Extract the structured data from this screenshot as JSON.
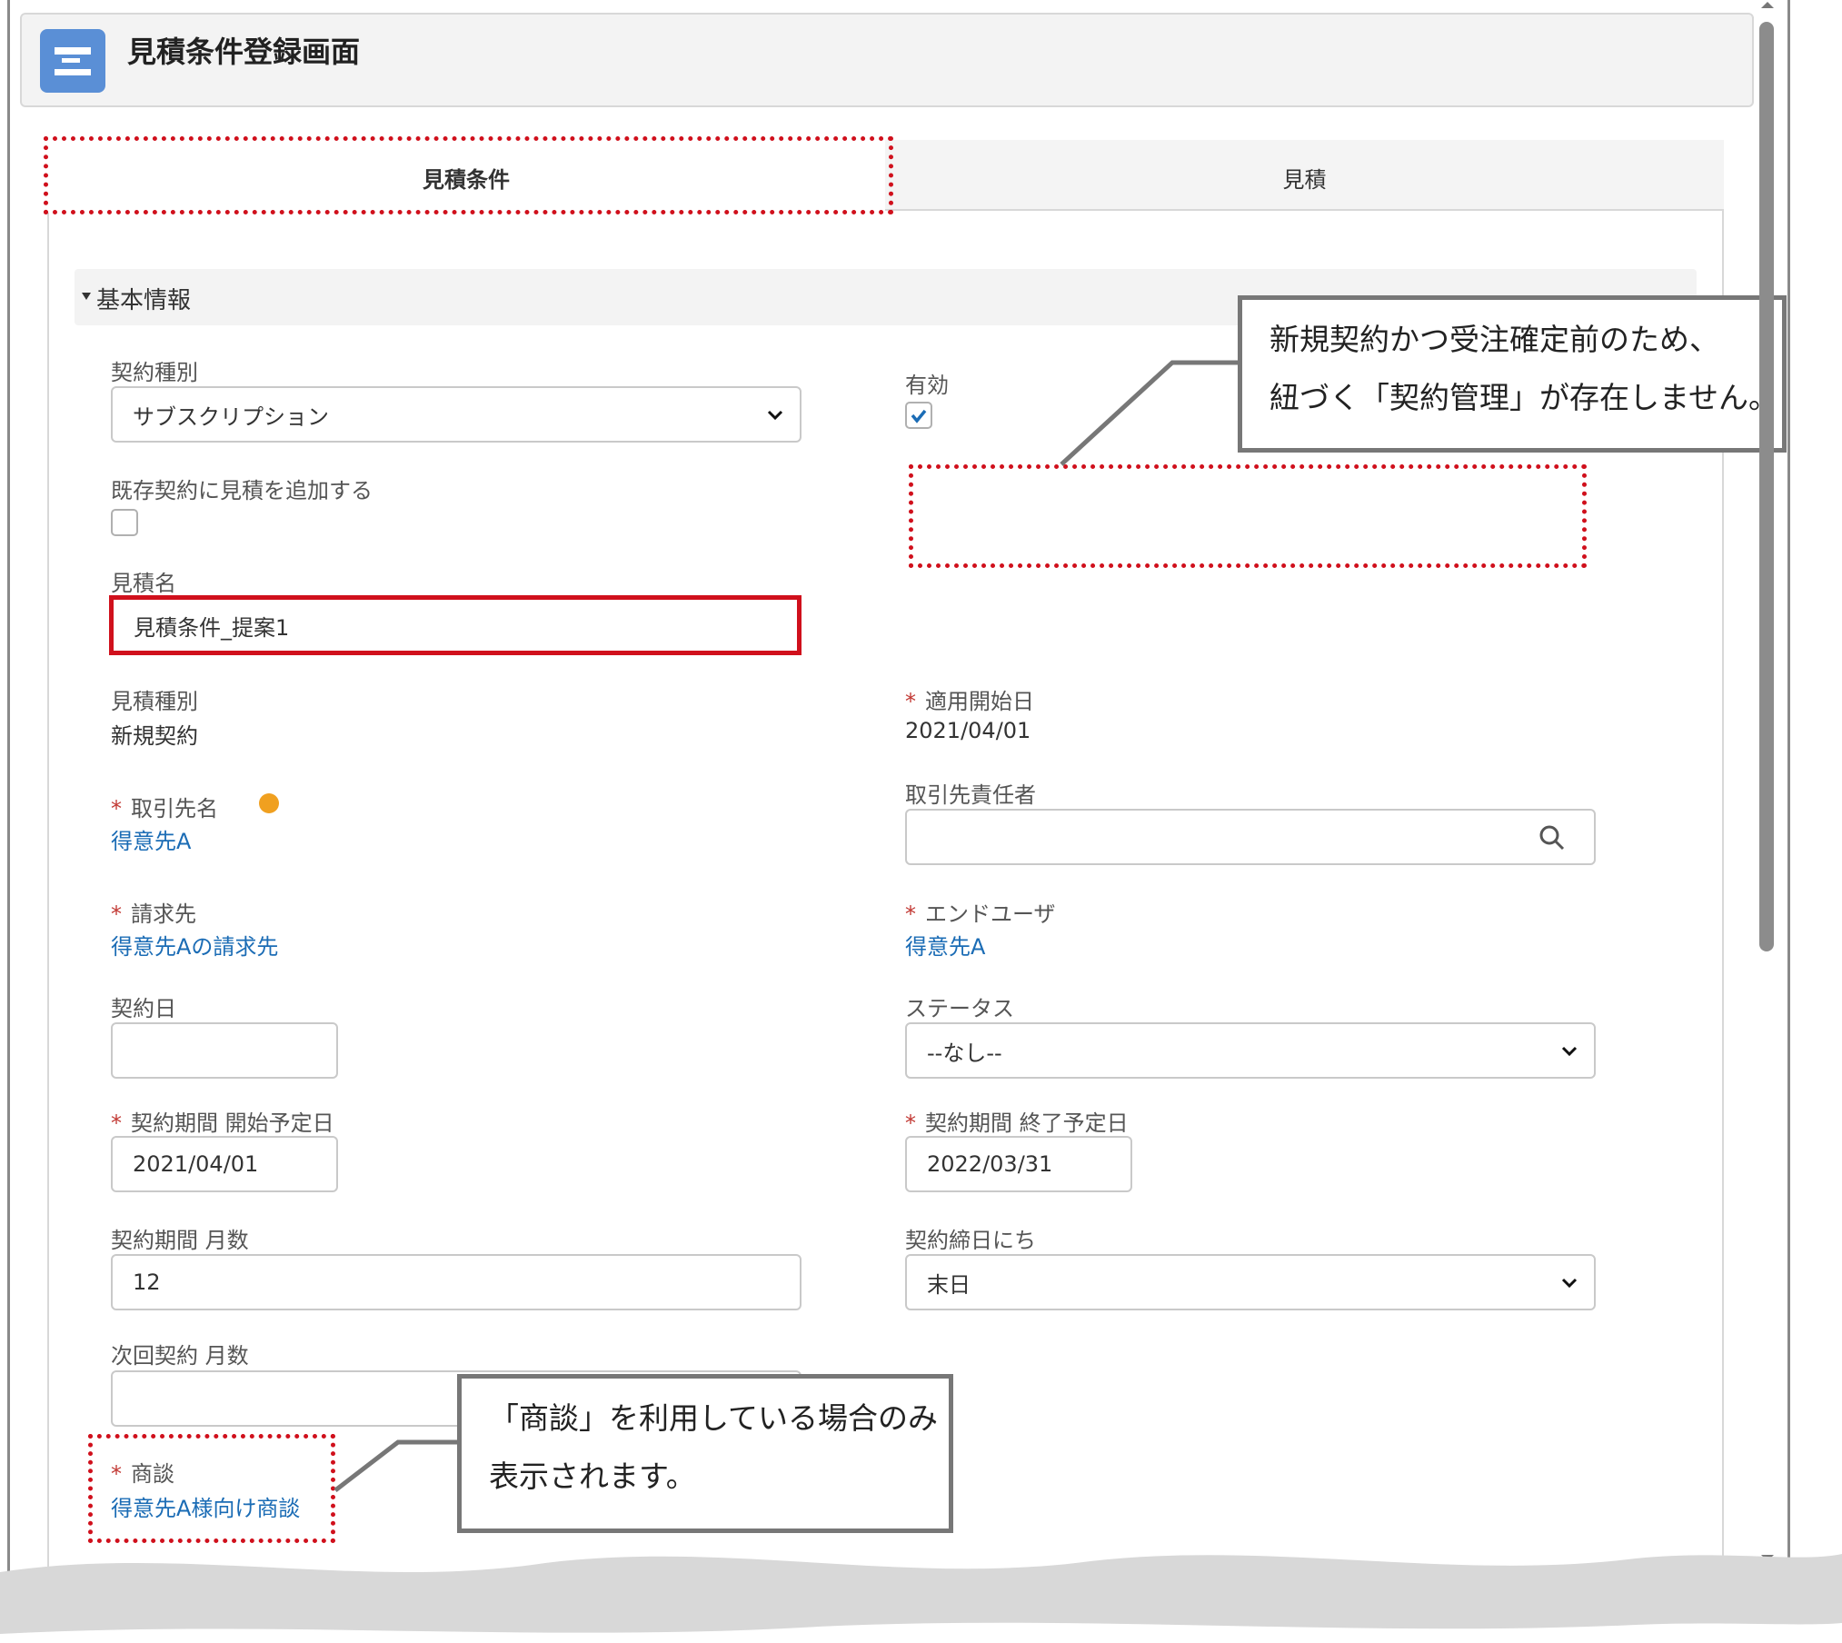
{
  "header": {
    "title": "見積条件登録画面"
  },
  "tabs": [
    {
      "label": "見積条件",
      "active": true
    },
    {
      "label": "見積",
      "active": false
    }
  ],
  "section": {
    "title": "基本情報"
  },
  "fields": {
    "contract_type": {
      "label": "契約種別",
      "value": "サブスクリプション"
    },
    "active": {
      "label": "有効",
      "checked": true
    },
    "add_to_existing": {
      "label": "既存契約に見積を追加する",
      "checked": false
    },
    "quote_name": {
      "label": "見積名",
      "value": "見積条件_提案1"
    },
    "quote_type": {
      "label": "見積種別",
      "value": "新規契約"
    },
    "apply_start": {
      "label": "適用開始日",
      "value": "2021/04/01"
    },
    "account": {
      "label": "取引先名",
      "value": "得意先A"
    },
    "account_contact": {
      "label": "取引先責任者",
      "value": ""
    },
    "bill_to": {
      "label": "請求先",
      "value": "得意先Aの請求先"
    },
    "end_user": {
      "label": "エンドユーザ",
      "value": "得意先A"
    },
    "contract_date": {
      "label": "契約日",
      "value": ""
    },
    "status": {
      "label": "ステータス",
      "value": "--なし--"
    },
    "period_start": {
      "label": "契約期間 開始予定日",
      "value": "2021/04/01"
    },
    "period_end": {
      "label": "契約期間 終了予定日",
      "value": "2022/03/31"
    },
    "period_months": {
      "label": "契約期間 月数",
      "value": "12"
    },
    "closing_day": {
      "label": "契約締日にち",
      "value": "末日"
    },
    "next_months": {
      "label": "次回契約 月数",
      "value": ""
    },
    "opportunity": {
      "label": "商談",
      "value": "得意先A様向け商談"
    }
  },
  "callouts": {
    "top": {
      "line1": "新規契約かつ受注確定前のため、",
      "line2": "紐づく「契約管理」が存在しません。"
    },
    "bottom": {
      "line1": "「商談」を利用している場合のみ",
      "line2": "表示されます。"
    }
  },
  "colors": {
    "link": "#1b6cb5",
    "required": "#c23934",
    "highlight": "#d0101c",
    "header_icon": "#5a8fd6",
    "check": "#1b6cb5"
  }
}
